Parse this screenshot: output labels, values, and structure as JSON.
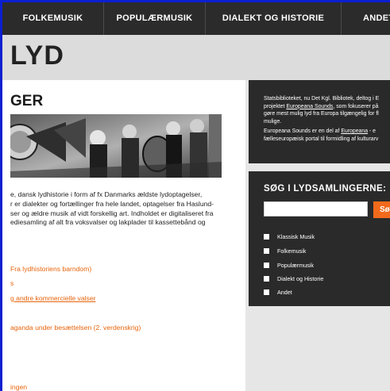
{
  "nav": {
    "items": [
      "FOLKEMUSIK",
      "POPULÆRMUSIK",
      "DIALEKT OG HISTORIE",
      "ANDET"
    ]
  },
  "site": {
    "title": "LYD"
  },
  "main": {
    "heading": "GER",
    "intro_lines": [
      "e, dansk lydhistorie i form af fx Danmarks ældste lydoptagelser,",
      "r er dialekter og fortællinger fra hele landet, optagelser fra Haslund-",
      "ser og ældre musik af vidt forskellig art. Indholdet er digitaliseret fra",
      "ediesamling af alt fra voksvalser og lakplader til kassettebånd og"
    ],
    "links": [
      "Fra lydhistoriens barndom)",
      "s",
      "g andre kommercielle valser",
      "aganda under besættelsen (2. verdenskrig)",
      "ingen"
    ]
  },
  "info": {
    "line1": "Statsbiblioteket, nu Det Kgl. Bibliotek, deltog i E",
    "line2_pre": "projektet ",
    "line2_link": "Europeana Sounds",
    "line2_post": ", som fokuserer på",
    "line3": "gøre mest mulig lyd fra Europa tilgængelig for fl",
    "line4": "mulige.",
    "line5_pre": "Europeana Sounds er en del af ",
    "line5_link": "Europeana",
    "line5_post": " - e",
    "line6": "fælleseuropæisk portal til formidling af kulturarv"
  },
  "search": {
    "title": "SØG I LYDSAMLINGERNE:",
    "placeholder": "",
    "button_label": "Sø",
    "categories": [
      "Klassisk Musik",
      "Folkemusik",
      "Populærmusik",
      "Dialekt og Historie",
      "Andet"
    ]
  },
  "colors": {
    "accent": "#e8640c",
    "nav_bg": "#2b2b2b",
    "panel_bg": "#2a2a2a",
    "frame": "#0b1fd0"
  }
}
